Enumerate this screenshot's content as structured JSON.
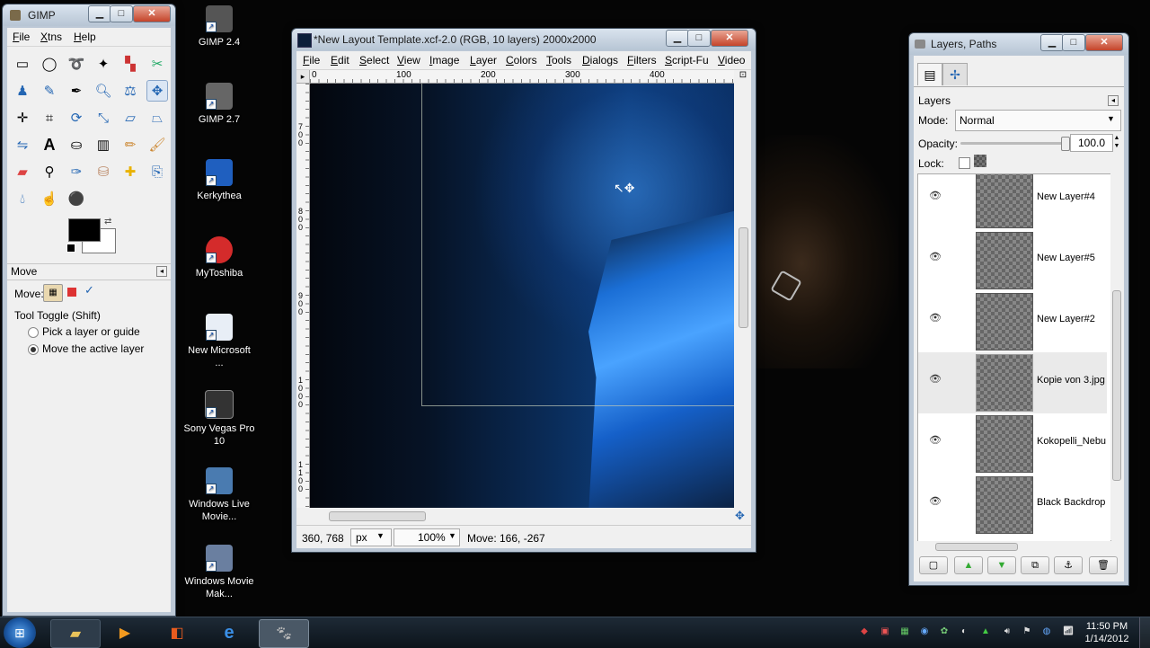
{
  "desktop": {
    "icons": [
      {
        "label": "GIMP 2.4"
      },
      {
        "label": "GIMP 2.7"
      },
      {
        "label": "Kerkythea"
      },
      {
        "label": "MyToshiba"
      },
      {
        "label": "New Microsoft ..."
      },
      {
        "label": "Sony Vegas Pro 10"
      },
      {
        "label": "Windows Live Movie..."
      },
      {
        "label": "Windows Movie Mak..."
      }
    ]
  },
  "toolbox": {
    "title": "GIMP",
    "menu": [
      "File",
      "Xtns",
      "Help"
    ],
    "tool_options_title": "Move",
    "move_label": "Move:",
    "tool_toggle": "Tool Toggle  (Shift)",
    "options": [
      {
        "label": "Pick a layer or guide",
        "selected": false
      },
      {
        "label": "Move the active layer",
        "selected": true
      }
    ],
    "fg_color": "#000000",
    "bg_color": "#ffffff"
  },
  "image_window": {
    "title": "*New Layout Template.xcf-2.0 (RGB, 10 layers) 2000x2000",
    "menu": [
      "File",
      "Edit",
      "Select",
      "View",
      "Image",
      "Layer",
      "Colors",
      "Tools",
      "Dialogs",
      "Filters",
      "Script-Fu",
      "Video"
    ],
    "ruler_h": [
      "0",
      "100",
      "200",
      "300",
      "400"
    ],
    "ruler_v": [
      "7\n0\n0",
      "8\n0\n0",
      "9\n0\n0",
      "1\n0\n0\n0",
      "1\n1\n0\n0"
    ],
    "coords": "360, 768",
    "unit": "px",
    "zoom": "100%",
    "status": "Move: 166, -267"
  },
  "layers_window": {
    "title": "Layers, Paths",
    "panel_title": "Layers",
    "mode_label": "Mode:",
    "mode_value": "Normal",
    "opacity_label": "Opacity:",
    "opacity_value": "100.0",
    "lock_label": "Lock:",
    "layers": [
      {
        "name": "New Layer#4"
      },
      {
        "name": "New Layer#5"
      },
      {
        "name": "New Layer#2"
      },
      {
        "name": "Kopie von 3.jpg",
        "selected": true
      },
      {
        "name": "Kokopelli_Nebu"
      },
      {
        "name": "Black Backdrop"
      }
    ]
  },
  "taskbar": {
    "time": "11:50 PM",
    "date": "1/14/2012"
  },
  "colors": {
    "accent": "#0a66d8",
    "title_bar": "#c9d6e4"
  }
}
